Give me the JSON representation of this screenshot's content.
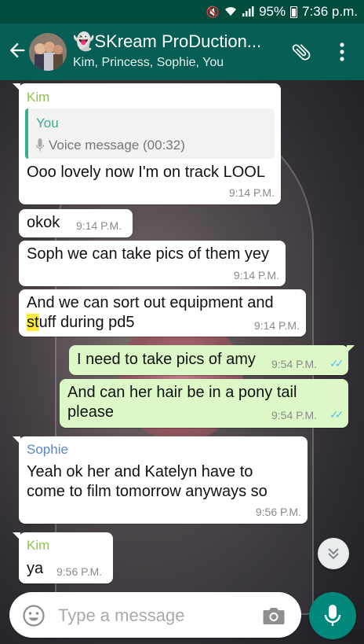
{
  "status_bar": {
    "battery": "95%",
    "time": "7:36 p.m."
  },
  "header": {
    "title": "👻SKream ProDuction...",
    "participants": "Kim, Princess, Sophie, You"
  },
  "colors": {
    "header": "#075e54",
    "status_bar": "#004d40",
    "incoming_bubble": "#ffffff",
    "outgoing_bubble": "#dcf8c6",
    "kim_name": "#8bc34a",
    "sophie_name": "#5b86c5",
    "read_ticks": "#4fc3f7",
    "fab": "#00897b"
  },
  "messages": [
    {
      "sender": "Kim",
      "quote_name": "You",
      "quote_text": "Voice message (00:32)",
      "text": "Ooo lovely now I'm on track LOOL",
      "time": "9:14 P.M."
    },
    {
      "text": "okok",
      "time": "9:14 P.M."
    },
    {
      "text": "Soph we can take pics of them yey",
      "time": "9:14 P.M."
    },
    {
      "text_line1": "And we can sort out equipment and",
      "text_line2_hl": "st",
      "text_line2_rest": "uff during pd5",
      "time": "9:14 P.M."
    },
    {
      "text": "I need to take pics of amy",
      "time": "9:54 P.M.",
      "ticks": "✓✓"
    },
    {
      "text_line1": "And can her hair be in a pony tail",
      "text_line2": "please",
      "time": "9:54 P.M.",
      "ticks": "✓✓"
    },
    {
      "sender": "Sophie",
      "text_line1": "Yeah ok her and Katelyn have to",
      "text_line2": "come to film tomorrow anyways so",
      "time": "9:56 P.M."
    },
    {
      "sender": "Kim",
      "text": "ya",
      "time": "9:56 P.M."
    }
  ],
  "composer": {
    "placeholder": "Type a message"
  }
}
